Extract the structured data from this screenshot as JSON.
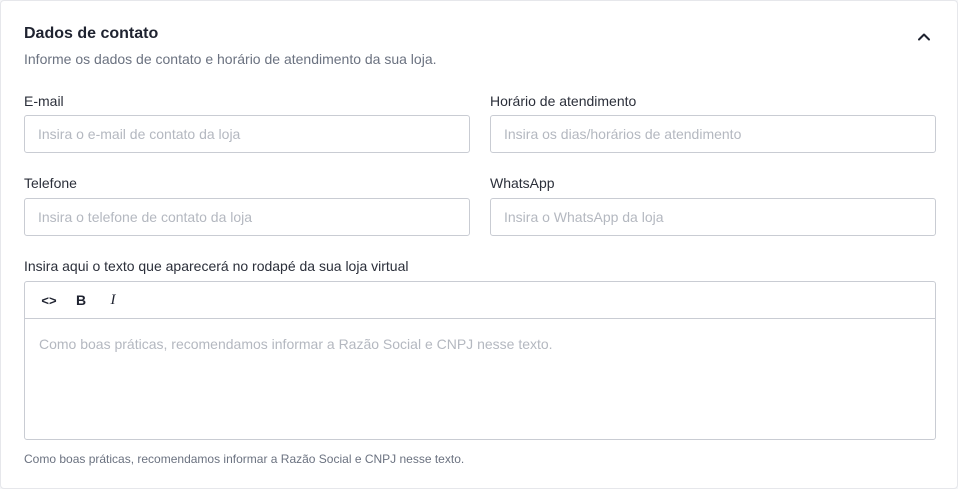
{
  "section": {
    "title": "Dados de contato",
    "subtitle": "Informe os dados de contato e horário de atendimento da sua loja."
  },
  "fields": {
    "email": {
      "label": "E-mail",
      "placeholder": "Insira o e-mail de contato da loja",
      "value": ""
    },
    "hours": {
      "label": "Horário de atendimento",
      "placeholder": "Insira os dias/horários de atendimento",
      "value": ""
    },
    "phone": {
      "label": "Telefone",
      "placeholder": "Insira o telefone de contato da loja",
      "value": ""
    },
    "whatsapp": {
      "label": "WhatsApp",
      "placeholder": "Insira o WhatsApp da loja",
      "value": ""
    }
  },
  "footer_editor": {
    "label": "Insira aqui o texto que aparecerá no rodapé da sua loja virtual",
    "toolbar": {
      "code": "<>",
      "bold": "B",
      "italic": "I"
    },
    "placeholder": "Como boas práticas, recomendamos informar a Razão Social e CNPJ nesse texto.",
    "help": "Como boas práticas, recomendamos informar a Razão Social e CNPJ nesse texto."
  },
  "icons": {
    "collapse": "chevron-up-icon"
  },
  "colors": {
    "text": "#1f2330",
    "muted": "#6b7280",
    "border": "#c9ccd3",
    "placeholder": "#b4b8c0"
  }
}
